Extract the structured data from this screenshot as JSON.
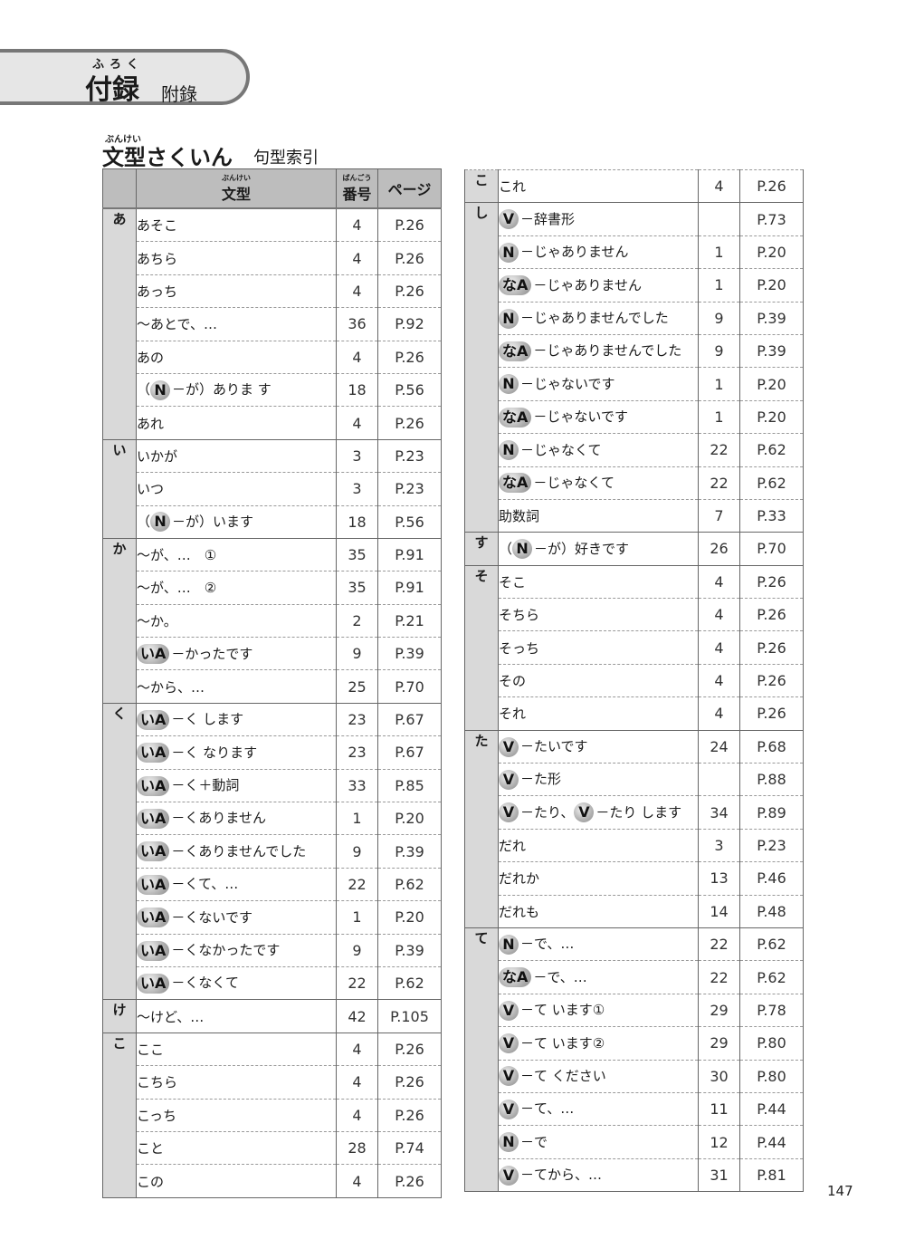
{
  "appendix": {
    "ruby": "ふろく",
    "title": "付録",
    "subtitle": "附錄"
  },
  "section": {
    "ruby": "ぶんけい",
    "title": "文型さくいん",
    "subtitle": "句型索引"
  },
  "headers": {
    "pattern_ruby": "ぶんけい",
    "pattern": "文型",
    "number_ruby": "ばんごう",
    "number": "番号",
    "page": "ページ"
  },
  "left_groups": [
    {
      "kana": "あ",
      "rows": [
        {
          "badge": "",
          "text": "あそこ",
          "num": "4",
          "page": "P.26"
        },
        {
          "badge": "",
          "text": "あちら",
          "num": "4",
          "page": "P.26"
        },
        {
          "badge": "",
          "text": "あっち",
          "num": "4",
          "page": "P.26"
        },
        {
          "badge": "",
          "text": "～あとで、…",
          "num": "36",
          "page": "P.92"
        },
        {
          "badge": "",
          "text": "あの",
          "num": "4",
          "page": "P.26"
        },
        {
          "prefix": "（",
          "badge": "N",
          "text": "－が）ありま す",
          "num": "18",
          "page": "P.56"
        },
        {
          "badge": "",
          "text": "あれ",
          "num": "4",
          "page": "P.26"
        }
      ]
    },
    {
      "kana": "い",
      "rows": [
        {
          "badge": "",
          "text": "いかが",
          "num": "3",
          "page": "P.23"
        },
        {
          "badge": "",
          "text": "いつ",
          "num": "3",
          "page": "P.23"
        },
        {
          "prefix": "（",
          "badge": "N",
          "text": "－が）います",
          "num": "18",
          "page": "P.56"
        }
      ]
    },
    {
      "kana": "か",
      "rows": [
        {
          "badge": "",
          "text": "～が、…　①",
          "num": "35",
          "page": "P.91"
        },
        {
          "badge": "",
          "text": "～が、…　②",
          "num": "35",
          "page": "P.91"
        },
        {
          "badge": "",
          "text": "～か。",
          "num": "2",
          "page": "P.21"
        },
        {
          "badge": "いA",
          "text": "－かったです",
          "num": "9",
          "page": "P.39"
        },
        {
          "badge": "",
          "text": "～から、…",
          "num": "25",
          "page": "P.70"
        }
      ]
    },
    {
      "kana": "く",
      "rows": [
        {
          "badge": "いA",
          "text": "－く します",
          "num": "23",
          "page": "P.67"
        },
        {
          "badge": "いA",
          "text": "－く なります",
          "num": "23",
          "page": "P.67"
        },
        {
          "badge": "いA",
          "text": "－く＋動詞",
          "num": "33",
          "page": "P.85"
        },
        {
          "badge": "いA",
          "text": "－くありません",
          "num": "1",
          "page": "P.20"
        },
        {
          "badge": "いA",
          "text": "－くありませんでした",
          "num": "9",
          "page": "P.39"
        },
        {
          "badge": "いA",
          "text": "－くて、…",
          "num": "22",
          "page": "P.62"
        },
        {
          "badge": "いA",
          "text": "－くないです",
          "num": "1",
          "page": "P.20"
        },
        {
          "badge": "いA",
          "text": "－くなかったです",
          "num": "9",
          "page": "P.39"
        },
        {
          "badge": "いA",
          "text": "－くなくて",
          "num": "22",
          "page": "P.62"
        }
      ]
    },
    {
      "kana": "け",
      "rows": [
        {
          "badge": "",
          "text": "～けど、…",
          "num": "42",
          "page": "P.105"
        }
      ]
    },
    {
      "kana": "こ",
      "rows": [
        {
          "badge": "",
          "text": "ここ",
          "num": "4",
          "page": "P.26"
        },
        {
          "badge": "",
          "text": "こちら",
          "num": "4",
          "page": "P.26"
        },
        {
          "badge": "",
          "text": "こっち",
          "num": "4",
          "page": "P.26"
        },
        {
          "badge": "",
          "text": "こと",
          "num": "28",
          "page": "P.74"
        },
        {
          "badge": "",
          "text": "この",
          "num": "4",
          "page": "P.26"
        }
      ]
    }
  ],
  "right_groups": [
    {
      "kana": "こ",
      "rows": [
        {
          "badge": "",
          "text": "これ",
          "num": "4",
          "page": "P.26"
        }
      ]
    },
    {
      "kana": "し",
      "rows": [
        {
          "badge": "V",
          "text": "－辞書形",
          "num": "",
          "page": "P.73"
        },
        {
          "badge": "N",
          "text": "－じゃありません",
          "num": "1",
          "page": "P.20"
        },
        {
          "badge": "なA",
          "text": "－じゃありません",
          "num": "1",
          "page": "P.20"
        },
        {
          "badge": "N",
          "text": "－じゃありませんでした",
          "num": "9",
          "page": "P.39"
        },
        {
          "badge": "なA",
          "text": "－じゃありませんでした",
          "num": "9",
          "page": "P.39"
        },
        {
          "badge": "N",
          "text": "－じゃないです",
          "num": "1",
          "page": "P.20"
        },
        {
          "badge": "なA",
          "text": "－じゃないです",
          "num": "1",
          "page": "P.20"
        },
        {
          "badge": "N",
          "text": "－じゃなくて",
          "num": "22",
          "page": "P.62"
        },
        {
          "badge": "なA",
          "text": "－じゃなくて",
          "num": "22",
          "page": "P.62"
        },
        {
          "badge": "",
          "text": "助数詞",
          "num": "7",
          "page": "P.33"
        }
      ]
    },
    {
      "kana": "す",
      "rows": [
        {
          "prefix": "（",
          "badge": "N",
          "text": "－が）好きです",
          "num": "26",
          "page": "P.70"
        }
      ]
    },
    {
      "kana": "そ",
      "rows": [
        {
          "badge": "",
          "text": "そこ",
          "num": "4",
          "page": "P.26"
        },
        {
          "badge": "",
          "text": "そちら",
          "num": "4",
          "page": "P.26"
        },
        {
          "badge": "",
          "text": "そっち",
          "num": "4",
          "page": "P.26"
        },
        {
          "badge": "",
          "text": "その",
          "num": "4",
          "page": "P.26"
        },
        {
          "badge": "",
          "text": "それ",
          "num": "4",
          "page": "P.26"
        }
      ]
    },
    {
      "kana": "た",
      "rows": [
        {
          "badge": "V",
          "text": "－たいです",
          "num": "24",
          "page": "P.68"
        },
        {
          "badge": "V",
          "text": "－た形",
          "num": "",
          "page": "P.88"
        },
        {
          "badge": "V",
          "text": "－たり、",
          "badge2": "V",
          "text2": "－たり します",
          "num": "34",
          "page": "P.89"
        },
        {
          "badge": "",
          "text": "だれ",
          "num": "3",
          "page": "P.23"
        },
        {
          "badge": "",
          "text": "だれか",
          "num": "13",
          "page": "P.46"
        },
        {
          "badge": "",
          "text": "だれも",
          "num": "14",
          "page": "P.48"
        }
      ]
    },
    {
      "kana": "て",
      "rows": [
        {
          "badge": "N",
          "text": "－で、…",
          "num": "22",
          "page": "P.62"
        },
        {
          "badge": "なA",
          "text": "－で、…",
          "num": "22",
          "page": "P.62"
        },
        {
          "badge": "V",
          "text": "－て います①",
          "num": "29",
          "page": "P.78"
        },
        {
          "badge": "V",
          "text": "－て います②",
          "num": "29",
          "page": "P.80"
        },
        {
          "badge": "V",
          "text": "－て ください",
          "num": "30",
          "page": "P.80"
        },
        {
          "badge": "V",
          "text": "－て、…",
          "num": "11",
          "page": "P.44"
        },
        {
          "badge": "N",
          "text": "－で",
          "num": "12",
          "page": "P.44"
        },
        {
          "badge": "V",
          "text": "－てから、…",
          "num": "31",
          "page": "P.81"
        }
      ]
    }
  ],
  "page_number": "147"
}
